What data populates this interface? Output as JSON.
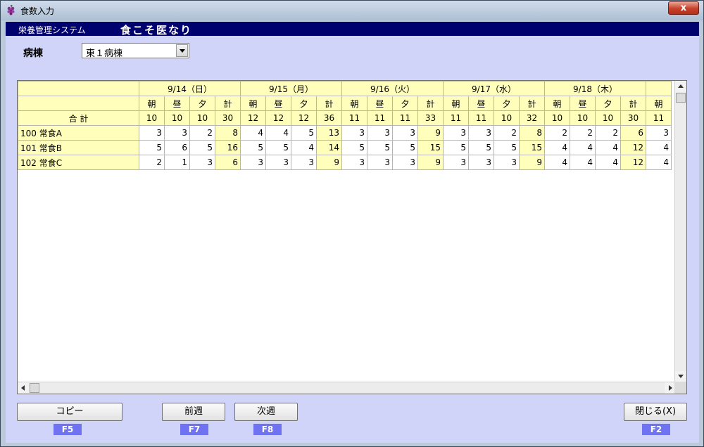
{
  "window": {
    "title": "食数入力",
    "close_glyph": "x"
  },
  "banner": {
    "system_name": "栄養管理システム",
    "brand": "食こそ医なり"
  },
  "ward": {
    "label": "病棟",
    "selected": "東１病棟"
  },
  "grid": {
    "dates": [
      "9/14（日）",
      "9/15（月）",
      "9/16（火）",
      "9/17（水）",
      "9/18（木）"
    ],
    "meals": [
      "朝",
      "昼",
      "夕",
      "計"
    ],
    "partial_meal": "朝",
    "total_label": "合  計",
    "totals": [
      [
        "10",
        "10",
        "10",
        "30"
      ],
      [
        "12",
        "12",
        "12",
        "36"
      ],
      [
        "11",
        "11",
        "11",
        "33"
      ],
      [
        "11",
        "11",
        "10",
        "32"
      ],
      [
        "10",
        "10",
        "10",
        "30"
      ]
    ],
    "totals_partial": "11",
    "rows": [
      {
        "name": "100 常食A",
        "values": [
          [
            "3",
            "3",
            "2",
            "8"
          ],
          [
            "4",
            "4",
            "5",
            "13"
          ],
          [
            "3",
            "3",
            "3",
            "9"
          ],
          [
            "3",
            "3",
            "2",
            "8"
          ],
          [
            "2",
            "2",
            "2",
            "6"
          ]
        ],
        "partial": "3"
      },
      {
        "name": "101 常食B",
        "values": [
          [
            "5",
            "6",
            "5",
            "16"
          ],
          [
            "5",
            "5",
            "4",
            "14"
          ],
          [
            "5",
            "5",
            "5",
            "15"
          ],
          [
            "5",
            "5",
            "5",
            "15"
          ],
          [
            "4",
            "4",
            "4",
            "12"
          ]
        ],
        "partial": "4"
      },
      {
        "name": "102 常食C",
        "values": [
          [
            "2",
            "1",
            "3",
            "6"
          ],
          [
            "3",
            "3",
            "3",
            "9"
          ],
          [
            "3",
            "3",
            "3",
            "9"
          ],
          [
            "3",
            "3",
            "3",
            "9"
          ],
          [
            "4",
            "4",
            "4",
            "12"
          ]
        ],
        "partial": "4"
      }
    ]
  },
  "buttons": {
    "copy": "コピー",
    "copy_key": "F5",
    "prev_week": "前週",
    "prev_week_key": "F7",
    "next_week": "次週",
    "next_week_key": "F8",
    "close": "閉じる(X)",
    "close_key": "F2"
  },
  "colors": {
    "banner": "#00006e",
    "client_bg": "#d0d4f8",
    "cell_yellow": "#ffffbb",
    "fkey_bg": "#6f73f2"
  },
  "icons": {
    "app": "grape-icon"
  }
}
